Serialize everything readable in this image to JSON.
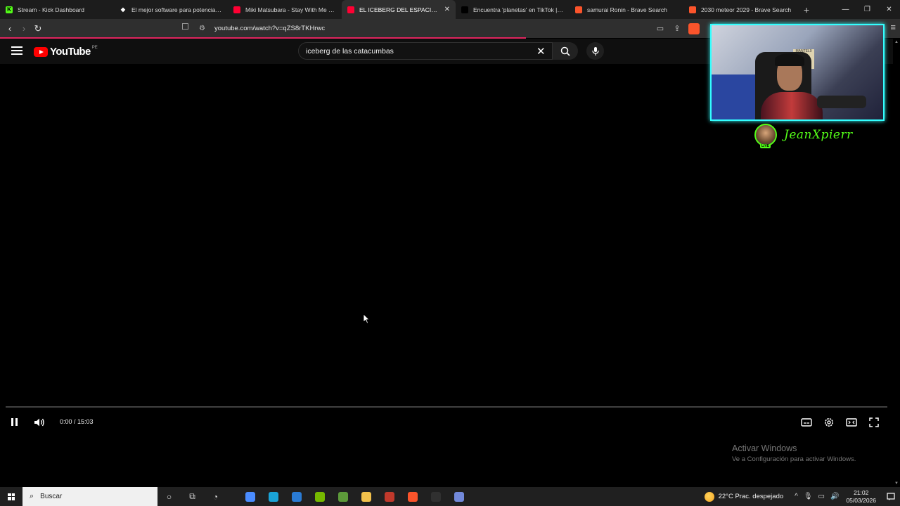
{
  "browser": {
    "tabs": [
      {
        "title": "Stream - Kick Dashboard",
        "favicon_color": "#53fc18",
        "favicon_glyph": "K",
        "active": false
      },
      {
        "title": "El mejor software para potenciar tu s",
        "favicon_color": "#ffffff",
        "favicon_glyph": "◆",
        "active": false
      },
      {
        "title": "Miki Matsubara - Stay With Me HD (",
        "favicon_color": "#ff0033",
        "favicon_glyph": "",
        "active": false
      },
      {
        "title": "EL ICEBERG DEL ESPACIO EXPLIC",
        "favicon_color": "#ff0033",
        "favicon_glyph": "",
        "active": true
      },
      {
        "title": "Encuentra 'planetas' en TikTok | Busc",
        "favicon_color": "#000000",
        "favicon_glyph": "♪",
        "active": false
      },
      {
        "title": "samurai Ronin - Brave Search",
        "favicon_color": "#fb542b",
        "favicon_glyph": "",
        "active": false
      },
      {
        "title": "2030 meteor 2029 - Brave Search",
        "favicon_color": "#fb542b",
        "favicon_glyph": "",
        "active": false
      }
    ],
    "new_tab_label": "+",
    "url": "youtube.com/watch?v=qZS8rTKHrwc",
    "icons": [
      "back-icon",
      "forward-icon",
      "reload-icon",
      "bookmark-icon",
      "site-info-icon",
      "cast-icon",
      "share-icon",
      "brave-shield-icon",
      "menu-icon"
    ]
  },
  "youtube": {
    "logo_text": "YouTube",
    "country_code": "PE",
    "search_value": "iceberg de las catacumbas",
    "player": {
      "time_display": "0:00 / 15:03",
      "progress": 0.0,
      "state": "playing"
    }
  },
  "overlay": {
    "streamer_name": "JeanXpierr",
    "live_badge": "LIVE",
    "poster_text": "MANTEL0"
  },
  "watermark": {
    "line1": "Activar Windows",
    "line2": "Ve a Configuración para activar Windows."
  },
  "taskbar": {
    "search_placeholder": "Buscar",
    "apps": [
      {
        "name": "store",
        "color": "#4a8cff"
      },
      {
        "name": "edge",
        "color": "#1aa4d8"
      },
      {
        "name": "mail",
        "color": "#2a7bd4"
      },
      {
        "name": "nvidia",
        "color": "#76b900"
      },
      {
        "name": "minecraft",
        "color": "#5d9a3a"
      },
      {
        "name": "files",
        "color": "#f2c14b"
      },
      {
        "name": "app-red-blue",
        "color": "#c0392b"
      },
      {
        "name": "brave",
        "color": "#fb542b"
      },
      {
        "name": "obs",
        "color": "#303030"
      },
      {
        "name": "discord",
        "color": "#7289da"
      }
    ],
    "weather": "22°C  Prac. despejado",
    "time": "21:02",
    "date": "05/03/2026"
  }
}
